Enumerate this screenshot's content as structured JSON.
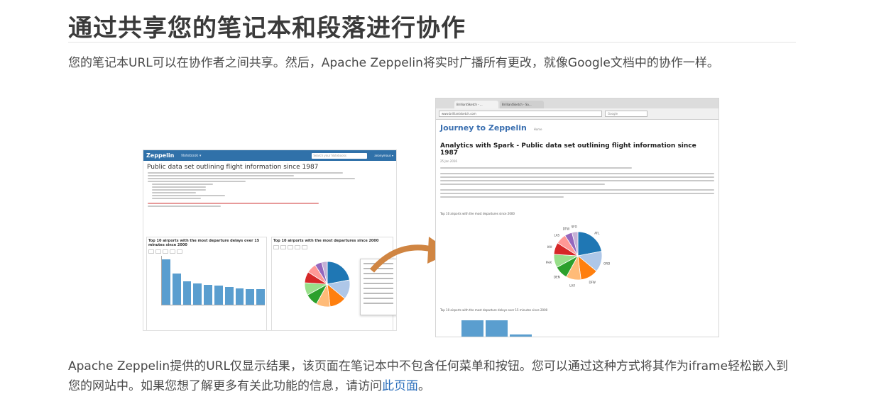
{
  "page": {
    "title": "通过共享您的笔记本和段落进行协作",
    "intro": "您的笔记本URL可以在协作者之间共享。然后，Apache Zeppelin将实时广播所有更改，就像Google文档中的协作一样。",
    "outro_text": "Apache Zeppelin提供的URL仅显示结果，该页面在笔记本中不包含任何菜单和按钮。您可以通过这种方式将其作为iframe轻松嵌入到您的网站中。如果您想了解更多有关此功能的信息，请访问",
    "outro_link": "此页面",
    "outro_end": "。"
  },
  "left_shot": {
    "logo": "Zeppelin",
    "nav_item": "Notebook ▾",
    "search_placeholder": "Search your Notebooks",
    "user": "anonymous ▾",
    "heading": "Public data set outlining flight information since 1987",
    "panel1_title": "Top 10 airports with the most departure delays over 15 minutes since 2000",
    "panel2_title": "Top 10 airports with the most departures since 2000",
    "bar_values": [
      1100,
      750,
      560,
      520,
      480,
      460,
      430,
      400,
      380,
      370
    ],
    "bar_max": 1200,
    "pie_values": [
      22,
      14,
      12,
      10,
      9,
      9,
      8,
      7,
      5,
      4
    ]
  },
  "right_shot": {
    "tab1": "BrilliantSketch - ...",
    "tab2": "BrilliantSketch - Sa...",
    "url": "www.brilliantsketch.com",
    "search": "Google",
    "blog_title": "Journey to Zeppelin",
    "blog_nav": "Home",
    "post_title": "Analytics with Spark - Public data set outlining flight information since 1987",
    "date": "25 Jan 2016",
    "chart1_caption": "Top 10 airports with the most departures since 2000",
    "chart2_caption": "Top 10 airports with the most departure delays over 15 minutes since 2000",
    "pie_values": [
      22,
      14,
      12,
      10,
      9,
      9,
      8,
      7,
      5,
      4
    ],
    "pie_labels": [
      "ATL",
      "ORD",
      "DFW",
      "LAX",
      "DEN",
      "PHX",
      "IAH",
      "LAS",
      "DTW",
      "SFO"
    ],
    "bar_values": [
      100,
      100,
      22
    ]
  },
  "colors": {
    "pie": [
      "#1f77b4",
      "#aec7e8",
      "#ff7f0e",
      "#ffbb78",
      "#2ca02c",
      "#98df8a",
      "#d62728",
      "#ff9896",
      "#9467bd",
      "#c5b0d5"
    ],
    "bar": "#5a9ecf",
    "arrow": "#d08542",
    "link": "#2a6ebb"
  }
}
